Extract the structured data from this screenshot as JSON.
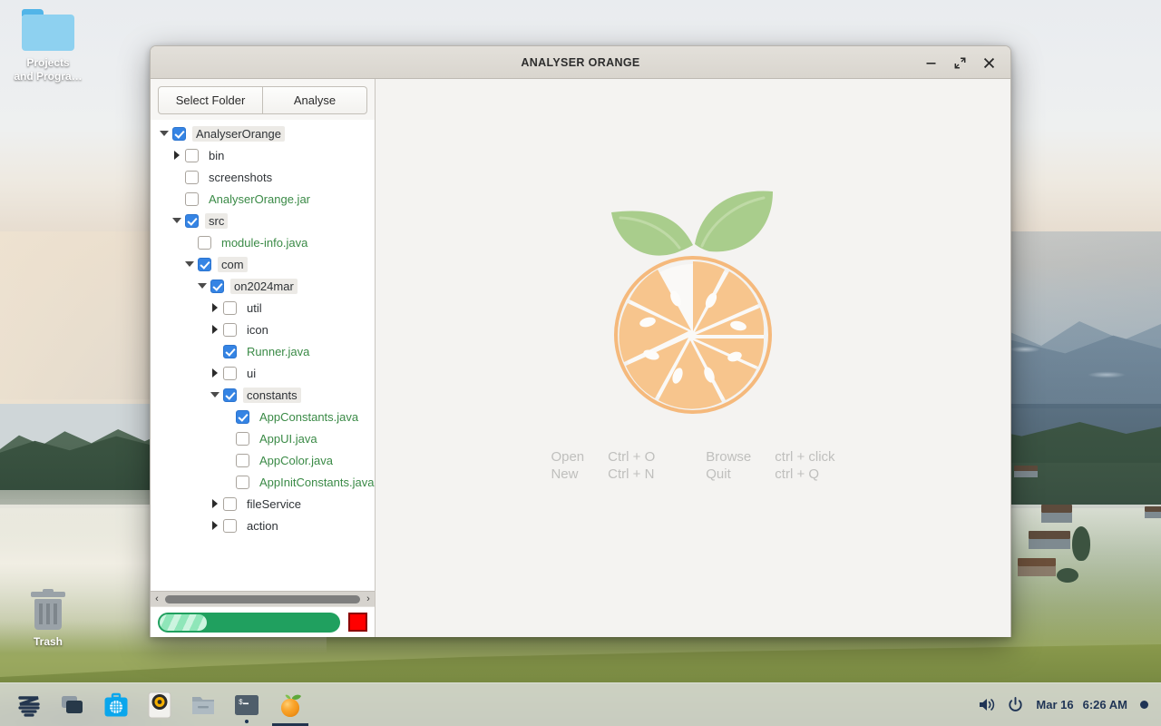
{
  "desktop": {
    "icons": [
      {
        "name": "Projects and Progra…",
        "line1": "Projects",
        "line2": "and Progra…",
        "glyph": "folder-icon"
      },
      {
        "name": "Trash",
        "line1": "Trash",
        "line2": "",
        "glyph": "trash-icon"
      }
    ]
  },
  "window": {
    "title": "ANALYSER ORANGE",
    "controls": {
      "minimize": "–",
      "maximize": "maximize",
      "close": "✕"
    }
  },
  "toolbar": {
    "select_folder_label": "Select Folder",
    "analyse_label": "Analyse"
  },
  "tree": [
    {
      "label": "AnalyserOrange",
      "depth": 0,
      "twisty": "down",
      "checked": true,
      "java": false,
      "selected": true
    },
    {
      "label": "bin",
      "depth": 1,
      "twisty": "right",
      "checked": false,
      "java": false,
      "selected": false
    },
    {
      "label": "screenshots",
      "depth": 1,
      "twisty": "none",
      "checked": false,
      "java": false,
      "selected": false
    },
    {
      "label": "AnalyserOrange.jar",
      "depth": 1,
      "twisty": "none",
      "checked": false,
      "java": true,
      "selected": false
    },
    {
      "label": "src",
      "depth": 1,
      "twisty": "down",
      "checked": true,
      "java": false,
      "selected": true
    },
    {
      "label": "module-info.java",
      "depth": 2,
      "twisty": "none",
      "checked": false,
      "java": true,
      "selected": false
    },
    {
      "label": "com",
      "depth": 2,
      "twisty": "down",
      "checked": true,
      "java": false,
      "selected": true
    },
    {
      "label": "on2024mar",
      "depth": 3,
      "twisty": "down",
      "checked": true,
      "java": false,
      "selected": true
    },
    {
      "label": "util",
      "depth": 4,
      "twisty": "right",
      "checked": false,
      "java": false,
      "selected": false
    },
    {
      "label": "icon",
      "depth": 4,
      "twisty": "right",
      "checked": false,
      "java": false,
      "selected": false
    },
    {
      "label": "Runner.java",
      "depth": 4,
      "twisty": "none",
      "checked": true,
      "java": true,
      "selected": false
    },
    {
      "label": "ui",
      "depth": 4,
      "twisty": "right",
      "checked": false,
      "java": false,
      "selected": false
    },
    {
      "label": "constants",
      "depth": 4,
      "twisty": "down",
      "checked": true,
      "java": false,
      "selected": true
    },
    {
      "label": "AppConstants.java",
      "depth": 5,
      "twisty": "none",
      "checked": true,
      "java": true,
      "selected": false
    },
    {
      "label": "AppUI.java",
      "depth": 5,
      "twisty": "none",
      "checked": false,
      "java": true,
      "selected": false
    },
    {
      "label": "AppColor.java",
      "depth": 5,
      "twisty": "none",
      "checked": false,
      "java": true,
      "selected": false
    },
    {
      "label": "AppInitConstants.java",
      "depth": 5,
      "twisty": "none",
      "checked": false,
      "java": true,
      "selected": false
    },
    {
      "label": "fileService",
      "depth": 4,
      "twisty": "right",
      "checked": false,
      "java": false,
      "selected": false
    },
    {
      "label": "action",
      "depth": 4,
      "twisty": "right",
      "checked": false,
      "java": false,
      "selected": false
    }
  ],
  "scrollbar": {
    "left_arrow": "‹",
    "right_arrow": "›"
  },
  "status": {
    "progress_percent": 26,
    "progress_color": "#20a05f",
    "chunk_color": "#8fe6b9",
    "stop_color": "#ff0000"
  },
  "main": {
    "logo": "orange-slice-logo",
    "shortcuts": [
      {
        "action": "Open",
        "keys": "Ctrl + O"
      },
      {
        "action": "Browse",
        "keys": "ctrl + click"
      },
      {
        "action": "New",
        "keys": "Ctrl + N"
      },
      {
        "action": "Quit",
        "keys": "ctrl + Q"
      }
    ]
  },
  "taskbar": {
    "apps": [
      {
        "name": "zorin-menu-icon",
        "running": false,
        "active": false
      },
      {
        "name": "window-switcher-icon",
        "running": false,
        "active": false
      },
      {
        "name": "software-store-icon",
        "running": false,
        "active": false
      },
      {
        "name": "rhythmbox-icon",
        "running": false,
        "active": false
      },
      {
        "name": "file-manager-icon",
        "running": false,
        "active": false
      },
      {
        "name": "terminal-icon",
        "running": true,
        "active": false
      },
      {
        "name": "analyser-orange-icon",
        "running": false,
        "active": true
      }
    ],
    "date": "Mar 16",
    "time": "6:26 AM"
  }
}
